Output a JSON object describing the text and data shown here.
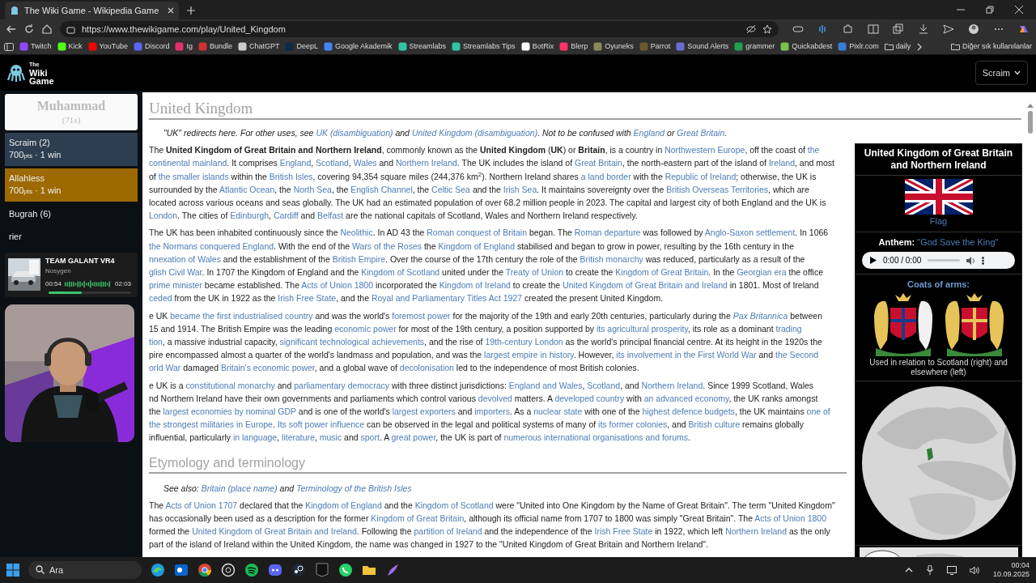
{
  "browser": {
    "tab_title": "The Wiki Game - Wikipedia Game",
    "url": "https://www.thewikigame.com/play/United_Kingdom",
    "bookmarks": [
      {
        "label": "Twitch",
        "kind": "site",
        "color": "#9146ff"
      },
      {
        "label": "Kick",
        "kind": "site",
        "color": "#53fc18"
      },
      {
        "label": "YouTube",
        "kind": "site",
        "color": "#ff0000"
      },
      {
        "label": "Discord",
        "kind": "site",
        "color": "#5865f2"
      },
      {
        "label": "Ig",
        "kind": "site",
        "color": "#e1306c"
      },
      {
        "label": "Bundle",
        "kind": "site",
        "color": "#d03030"
      },
      {
        "label": "ChatGPT",
        "kind": "site",
        "color": "#cccccc"
      },
      {
        "label": "DeepL",
        "kind": "site",
        "color": "#0f2b46"
      },
      {
        "label": "Google Akademik",
        "kind": "site",
        "color": "#4285f4"
      },
      {
        "label": "Streamlabs",
        "kind": "site",
        "color": "#31c3a2"
      },
      {
        "label": "Streamlabs Tips",
        "kind": "site",
        "color": "#31c3a2"
      },
      {
        "label": "BotRix",
        "kind": "site",
        "color": "#ffffff"
      },
      {
        "label": "Blerp",
        "kind": "site",
        "color": "#ff3366"
      },
      {
        "label": "Oyuneks",
        "kind": "site",
        "color": "#8a8a5a"
      },
      {
        "label": "Parrot",
        "kind": "site",
        "color": "#6b5a2a"
      },
      {
        "label": "Sound Alerts",
        "kind": "site",
        "color": "#6b6bd6"
      },
      {
        "label": "grammer",
        "kind": "site",
        "color": "#20a050"
      },
      {
        "label": "Quickabdest",
        "kind": "site",
        "color": "#7cc24a"
      },
      {
        "label": "Pixlr.com",
        "kind": "site",
        "color": "#3a7bd5"
      },
      {
        "label": "daily",
        "kind": "folder",
        "color": "#cccccc"
      }
    ],
    "more_bookmarks": "Diğer sık kullanılanlar"
  },
  "game": {
    "logo_lines": [
      "The",
      "Wiki",
      "Game"
    ],
    "user_menu": "Scraim",
    "target": {
      "title": "Muhammad",
      "time": "(71s)"
    },
    "players": [
      {
        "name": "Scraim (2)",
        "points": "700",
        "unit": "pts",
        "wins": "· 1 win",
        "color": "#2c3e50"
      },
      {
        "name": "Allahless",
        "points": "700",
        "unit": "pts",
        "wins": "· 1 win",
        "color": "#9c6a00"
      },
      {
        "name": "Bugrah (6)",
        "color": "#0b1014"
      },
      {
        "name": "rier",
        "color": "#0b1014"
      }
    ]
  },
  "music": {
    "title": "TEAM GALANT VR4",
    "artist": "Nosygen",
    "elapsed": "00:54",
    "total": "02:03",
    "level": 0.4
  },
  "article": {
    "title": "United Kingdom",
    "hatnote": [
      [
        {
          "kind": "text",
          "text": "\"UK\" redirects here. For other uses, see "
        },
        {
          "kind": "link",
          "text": "UK (disambiguation)"
        },
        {
          "kind": "text",
          "text": " and "
        },
        {
          "kind": "link",
          "text": "United Kingdom (disambiguation)"
        },
        {
          "kind": "text",
          "text": ". Not to be confused with "
        },
        {
          "kind": "link",
          "text": "England"
        },
        {
          "kind": "text",
          "text": " or "
        },
        {
          "kind": "link",
          "text": "Great Britain"
        },
        {
          "kind": "text",
          "text": "."
        }
      ]
    ],
    "blocks": [
      {
        "kind": "paragraph",
        "lines": [
          [
            {
              "kind": "text",
              "text": "The "
            },
            {
              "kind": "bold",
              "text": "United Kingdom of Great Britain and Northern Ireland"
            },
            {
              "kind": "text",
              "text": ", commonly known as the "
            },
            {
              "kind": "bold",
              "text": "United Kingdom"
            },
            {
              "kind": "text",
              "text": " ("
            },
            {
              "kind": "bold",
              "text": "UK"
            },
            {
              "kind": "text",
              "text": ") or "
            },
            {
              "kind": "bold",
              "text": "Britain"
            },
            {
              "kind": "text",
              "text": ", is a country in "
            },
            {
              "kind": "link",
              "text": "Northwestern Europe"
            },
            {
              "kind": "text",
              "text": ", off the coast of "
            },
            {
              "kind": "link",
              "text": "the"
            }
          ],
          [
            {
              "kind": "link",
              "text": "continental mainland"
            },
            {
              "kind": "text",
              "text": ". It comprises "
            },
            {
              "kind": "link",
              "text": "England"
            },
            {
              "kind": "text",
              "text": ", "
            },
            {
              "kind": "link",
              "text": "Scotland"
            },
            {
              "kind": "text",
              "text": ", "
            },
            {
              "kind": "link",
              "text": "Wales"
            },
            {
              "kind": "text",
              "text": " and "
            },
            {
              "kind": "link",
              "text": "Northern Ireland"
            },
            {
              "kind": "text",
              "text": ". The UK includes the island of "
            },
            {
              "kind": "link",
              "text": "Great Britain"
            },
            {
              "kind": "text",
              "text": ", the north-eastern part of the island of "
            },
            {
              "kind": "link",
              "text": "Ireland"
            },
            {
              "kind": "text",
              "text": ", and most"
            }
          ],
          [
            {
              "kind": "text",
              "text": "of "
            },
            {
              "kind": "link",
              "text": "the smaller islands"
            },
            {
              "kind": "text",
              "text": " within the "
            },
            {
              "kind": "link",
              "text": "British Isles"
            },
            {
              "kind": "text",
              "text": ", covering 94,354 square miles (244,376 km"
            },
            {
              "kind": "sup",
              "text": "2"
            },
            {
              "kind": "text",
              "text": "). Northern Ireland shares "
            },
            {
              "kind": "link",
              "text": "a land border"
            },
            {
              "kind": "text",
              "text": " with the "
            },
            {
              "kind": "link",
              "text": "Republic of Ireland"
            },
            {
              "kind": "text",
              "text": "; otherwise, the UK is"
            }
          ],
          [
            {
              "kind": "text",
              "text": "surrounded by the "
            },
            {
              "kind": "link",
              "text": "Atlantic Ocean"
            },
            {
              "kind": "text",
              "text": ", the "
            },
            {
              "kind": "link",
              "text": "North Sea"
            },
            {
              "kind": "text",
              "text": ", the "
            },
            {
              "kind": "link",
              "text": "English Channel"
            },
            {
              "kind": "text",
              "text": ", the "
            },
            {
              "kind": "link",
              "text": "Celtic Sea"
            },
            {
              "kind": "text",
              "text": " and the "
            },
            {
              "kind": "link",
              "text": "Irish Sea"
            },
            {
              "kind": "text",
              "text": ". It maintains sovereignty over the "
            },
            {
              "kind": "link",
              "text": "British Overseas Territories"
            },
            {
              "kind": "text",
              "text": ", which are"
            }
          ],
          [
            {
              "kind": "text",
              "text": "located across various oceans and seas globally. The UK had an estimated population of over 68.2 million people in 2023. The capital and largest city of both England and the UK is"
            }
          ],
          [
            {
              "kind": "link",
              "text": "London"
            },
            {
              "kind": "text",
              "text": ". The cities of "
            },
            {
              "kind": "link",
              "text": "Edinburgh"
            },
            {
              "kind": "text",
              "text": ", "
            },
            {
              "kind": "link",
              "text": "Cardiff"
            },
            {
              "kind": "text",
              "text": " and "
            },
            {
              "kind": "link",
              "text": "Belfast"
            },
            {
              "kind": "text",
              "text": " are the national capitals of Scotland, Wales and Northern Ireland respectively."
            }
          ]
        ]
      },
      {
        "kind": "paragraph",
        "lines": [
          [
            {
              "kind": "text",
              "text": "The UK has been inhabited continuously since the "
            },
            {
              "kind": "link",
              "text": "Neolithic"
            },
            {
              "kind": "text",
              "text": ". In AD 43 the "
            },
            {
              "kind": "link",
              "text": "Roman conquest of Britain"
            },
            {
              "kind": "text",
              "text": " began. The "
            },
            {
              "kind": "link",
              "text": "Roman departure"
            },
            {
              "kind": "text",
              "text": " was followed by "
            },
            {
              "kind": "link",
              "text": "Anglo-Saxon settlement"
            },
            {
              "kind": "text",
              "text": ". In 1066"
            }
          ],
          [
            {
              "kind": "link",
              "text": "the Normans conquered England"
            },
            {
              "kind": "text",
              "text": ". With the end of the "
            },
            {
              "kind": "link",
              "text": "Wars of the Roses"
            },
            {
              "kind": "text",
              "text": " the "
            },
            {
              "kind": "link",
              "text": "Kingdom of England"
            },
            {
              "kind": "text",
              "text": " stabilised and began to grow in power, resulting by the 16th century in the"
            }
          ],
          [
            {
              "kind": "link",
              "text": "nnexation of Wales"
            },
            {
              "kind": "text",
              "text": " and the establishment of the "
            },
            {
              "kind": "link",
              "text": "British Empire"
            },
            {
              "kind": "text",
              "text": ". Over the course of the 17th century the role of the "
            },
            {
              "kind": "link",
              "text": "British monarchy"
            },
            {
              "kind": "text",
              "text": " was reduced, particularly as a result of the"
            }
          ],
          [
            {
              "kind": "link",
              "text": "glish Civil War"
            },
            {
              "kind": "text",
              "text": ". In 1707 the Kingdom of England and the "
            },
            {
              "kind": "link",
              "text": "Kingdom of Scotland"
            },
            {
              "kind": "text",
              "text": " united under the "
            },
            {
              "kind": "link",
              "text": "Treaty of Union"
            },
            {
              "kind": "text",
              "text": " to create the "
            },
            {
              "kind": "link",
              "text": "Kingdom of Great Britain"
            },
            {
              "kind": "text",
              "text": ". In the "
            },
            {
              "kind": "link",
              "text": "Georgian era"
            },
            {
              "kind": "text",
              "text": " the office"
            }
          ],
          [
            {
              "kind": "link",
              "text": "prime minister"
            },
            {
              "kind": "text",
              "text": " became established. The "
            },
            {
              "kind": "link",
              "text": "Acts of Union 1800"
            },
            {
              "kind": "text",
              "text": " incorporated the "
            },
            {
              "kind": "link",
              "text": "Kingdom of Ireland"
            },
            {
              "kind": "text",
              "text": " to create the "
            },
            {
              "kind": "link",
              "text": "United Kingdom of Great Britain and Ireland"
            },
            {
              "kind": "text",
              "text": " in 1801. Most of Ireland"
            }
          ],
          [
            {
              "kind": "link",
              "text": "ceded"
            },
            {
              "kind": "text",
              "text": " from the UK in 1922 as the "
            },
            {
              "kind": "link",
              "text": "Irish Free State"
            },
            {
              "kind": "text",
              "text": ", and the "
            },
            {
              "kind": "link",
              "text": "Royal and Parliamentary Titles Act 1927"
            },
            {
              "kind": "text",
              "text": " created the present United Kingdom."
            }
          ]
        ]
      },
      {
        "kind": "paragraph",
        "lines": [
          [
            {
              "kind": "text",
              "text": "e UK "
            },
            {
              "kind": "link",
              "text": "became the first industrialised country"
            },
            {
              "kind": "text",
              "text": " and was the world's "
            },
            {
              "kind": "link",
              "text": "foremost power"
            },
            {
              "kind": "text",
              "text": " for the majority of the 19th and early 20th centuries, particularly during the "
            },
            {
              "kind": "italic-link",
              "text": "Pax Britannica"
            },
            {
              "kind": "text",
              "text": " between"
            }
          ],
          [
            {
              "kind": "text",
              "text": "15 and 1914. The British Empire was the leading "
            },
            {
              "kind": "link",
              "text": "economic power"
            },
            {
              "kind": "text",
              "text": " for most of the 19th century, a position supported by "
            },
            {
              "kind": "link",
              "text": "its agricultural prosperity"
            },
            {
              "kind": "text",
              "text": ", its role as a dominant "
            },
            {
              "kind": "link",
              "text": "trading"
            }
          ],
          [
            {
              "kind": "link",
              "text": "tion"
            },
            {
              "kind": "text",
              "text": ", a massive industrial capacity, "
            },
            {
              "kind": "link",
              "text": "significant technological achievements"
            },
            {
              "kind": "text",
              "text": ", and the rise of "
            },
            {
              "kind": "link",
              "text": "19th-century London"
            },
            {
              "kind": "text",
              "text": " as the world's principal financial centre. At its height in the 1920s the"
            }
          ],
          [
            {
              "kind": "text",
              "text": "pire encompassed almost a quarter of the world's landmass and population, and was the "
            },
            {
              "kind": "link",
              "text": "largest empire in history"
            },
            {
              "kind": "text",
              "text": ". However, "
            },
            {
              "kind": "link",
              "text": "its involvement in the First World War"
            },
            {
              "kind": "text",
              "text": " and "
            },
            {
              "kind": "link",
              "text": "the Second"
            }
          ],
          [
            {
              "kind": "link",
              "text": "orld War"
            },
            {
              "kind": "text",
              "text": " damaged "
            },
            {
              "kind": "link",
              "text": "Britain's economic power"
            },
            {
              "kind": "text",
              "text": ", and a global wave of "
            },
            {
              "kind": "link",
              "text": "decolonisation"
            },
            {
              "kind": "text",
              "text": " led to the independence of most British colonies."
            }
          ]
        ]
      },
      {
        "kind": "paragraph",
        "lines": [
          [
            {
              "kind": "text",
              "text": "e UK is a "
            },
            {
              "kind": "link",
              "text": "constitutional monarchy"
            },
            {
              "kind": "text",
              "text": " and "
            },
            {
              "kind": "link",
              "text": "parliamentary democracy"
            },
            {
              "kind": "text",
              "text": " with three distinct jurisdictions: "
            },
            {
              "kind": "link",
              "text": "England and Wales"
            },
            {
              "kind": "text",
              "text": ", "
            },
            {
              "kind": "link",
              "text": "Scotland"
            },
            {
              "kind": "text",
              "text": ", and "
            },
            {
              "kind": "link",
              "text": "Northern Ireland"
            },
            {
              "kind": "text",
              "text": ". Since 1999 Scotland, Wales"
            }
          ],
          [
            {
              "kind": "text",
              "text": "nd Northern Ireland have their own governments and parliaments which control various "
            },
            {
              "kind": "link",
              "text": "devolved"
            },
            {
              "kind": "text",
              "text": " matters. A "
            },
            {
              "kind": "link",
              "text": "developed country"
            },
            {
              "kind": "text",
              "text": " with "
            },
            {
              "kind": "link",
              "text": "an advanced economy"
            },
            {
              "kind": "text",
              "text": ", the UK ranks amongst"
            }
          ],
          [
            {
              "kind": "text",
              "text": "the "
            },
            {
              "kind": "link",
              "text": "largest economies by nominal GDP"
            },
            {
              "kind": "text",
              "text": " and is one of the world's "
            },
            {
              "kind": "link",
              "text": "largest exporters"
            },
            {
              "kind": "text",
              "text": " and "
            },
            {
              "kind": "link",
              "text": "importers"
            },
            {
              "kind": "text",
              "text": ". As a "
            },
            {
              "kind": "link",
              "text": "nuclear state"
            },
            {
              "kind": "text",
              "text": " with one of the "
            },
            {
              "kind": "link",
              "text": "highest defence budgets"
            },
            {
              "kind": "text",
              "text": ", the UK maintains "
            },
            {
              "kind": "link",
              "text": "one of"
            }
          ],
          [
            {
              "kind": "link",
              "text": "the strongest militaries in Europe"
            },
            {
              "kind": "text",
              "text": ". "
            },
            {
              "kind": "link",
              "text": "Its soft power influence"
            },
            {
              "kind": "text",
              "text": " can be observed in the legal and political systems of many of "
            },
            {
              "kind": "link",
              "text": "its former colonies"
            },
            {
              "kind": "text",
              "text": ", and "
            },
            {
              "kind": "link",
              "text": "British culture"
            },
            {
              "kind": "text",
              "text": " remains globally"
            }
          ],
          [
            {
              "kind": "text",
              "text": "influential, particularly "
            },
            {
              "kind": "link",
              "text": "in language"
            },
            {
              "kind": "text",
              "text": ", "
            },
            {
              "kind": "link",
              "text": "literature"
            },
            {
              "kind": "text",
              "text": ", "
            },
            {
              "kind": "link",
              "text": "music"
            },
            {
              "kind": "text",
              "text": " and "
            },
            {
              "kind": "link",
              "text": "sport"
            },
            {
              "kind": "text",
              "text": ". A "
            },
            {
              "kind": "link",
              "text": "great power"
            },
            {
              "kind": "text",
              "text": ", the UK is part of "
            },
            {
              "kind": "link",
              "text": "numerous international organisations and forums"
            },
            {
              "kind": "text",
              "text": "."
            }
          ]
        ]
      },
      {
        "kind": "heading",
        "text": "Etymology and terminology"
      },
      {
        "kind": "hatnote",
        "lines": [
          [
            {
              "kind": "text",
              "text": "See also: "
            },
            {
              "kind": "link",
              "text": "Britain (place name)"
            },
            {
              "kind": "text",
              "text": " and "
            },
            {
              "kind": "link",
              "text": "Terminology of the British Isles"
            }
          ]
        ]
      },
      {
        "kind": "paragraph",
        "lines": [
          [
            {
              "kind": "text",
              "text": "The "
            },
            {
              "kind": "link",
              "text": "Acts of Union 1707"
            },
            {
              "kind": "text",
              "text": " declared that the "
            },
            {
              "kind": "link",
              "text": "Kingdom of England"
            },
            {
              "kind": "text",
              "text": " and the "
            },
            {
              "kind": "link",
              "text": "Kingdom of Scotland"
            },
            {
              "kind": "text",
              "text": " were \"United into One Kingdom by the Name of Great Britain\". The term \"United Kingdom\""
            }
          ],
          [
            {
              "kind": "text",
              "text": "has occasionally been used as a description for the former "
            },
            {
              "kind": "link",
              "text": "Kingdom of Great Britain"
            },
            {
              "kind": "text",
              "text": ", although its official name from 1707 to 1800 was simply \"Great Britain\". The "
            },
            {
              "kind": "link",
              "text": "Acts of Union 1800"
            }
          ],
          [
            {
              "kind": "text",
              "text": "formed the "
            },
            {
              "kind": "link",
              "text": "United Kingdom of Great Britain and Ireland"
            },
            {
              "kind": "text",
              "text": ". Following the "
            },
            {
              "kind": "link",
              "text": "partition of Ireland"
            },
            {
              "kind": "text",
              "text": " and the independence of the "
            },
            {
              "kind": "link",
              "text": "Irish Free State"
            },
            {
              "kind": "text",
              "text": " in 1922, which left "
            },
            {
              "kind": "link",
              "text": "Northern Ireland"
            },
            {
              "kind": "text",
              "text": " as the only"
            }
          ],
          [
            {
              "kind": "text",
              "text": "part of the island of Ireland within the United Kingdom, the name was changed in 1927 to the \"United Kingdom of Great Britain and Northern Ireland\"."
            }
          ]
        ]
      }
    ]
  },
  "infobox": {
    "title": "United Kingdom of Great Britain and Northern Ireland",
    "flag_caption": "Flag",
    "anthem_label": "Anthem:",
    "anthem": "\"God Save the King\"",
    "audio_time": "0:00 / 0:00",
    "arms_label": "Coats of arms:",
    "arms_caption": "Used in relation to Scotland (right) and elsewhere (left)"
  },
  "taskbar": {
    "search_placeholder": "Ara",
    "time": "00:04",
    "date": "10.09.2025"
  }
}
